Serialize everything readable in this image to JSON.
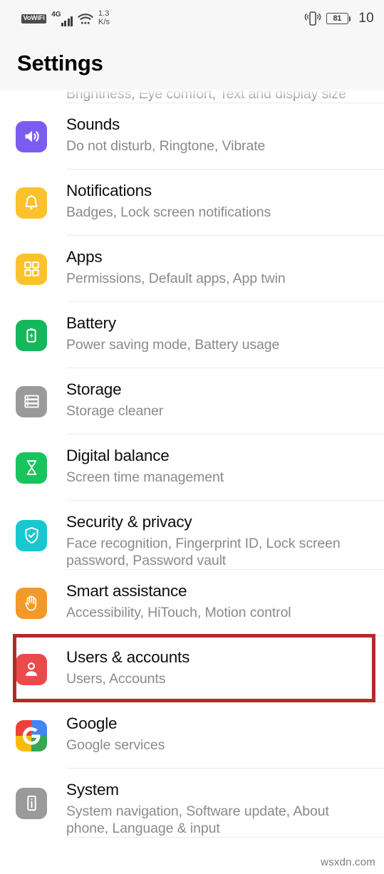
{
  "status_bar": {
    "vowifi_label": "VoWiFi",
    "network_label": "4G",
    "network_sub": "⁴ᴳ",
    "data_speed_value": "1.3",
    "data_speed_unit": "K/s",
    "battery_percent": "81",
    "clock": "10",
    "signal_bars": 4,
    "icons": {
      "wifi": "wifi-icon",
      "vibrate": "vibrate-icon",
      "battery": "battery-icon"
    }
  },
  "header": {
    "title": "Settings"
  },
  "highlight": {
    "color": "#b42a2a",
    "target": "Users & accounts"
  },
  "watermark": "wsxdn.com",
  "settings_list": [
    {
      "id": "display",
      "title": "",
      "subtitle": "Brightness, Eye comfort, Text and display size",
      "icon": "display-icon",
      "icon_color": "#2b9cf0",
      "partial": true
    },
    {
      "id": "sounds",
      "title": "Sounds",
      "subtitle": "Do not disturb, Ringtone, Vibrate",
      "icon": "speaker-icon",
      "icon_color": "#7c5cf0"
    },
    {
      "id": "notifications",
      "title": "Notifications",
      "subtitle": "Badges, Lock screen notifications",
      "icon": "bell-icon",
      "icon_color": "#fbc22d"
    },
    {
      "id": "apps",
      "title": "Apps",
      "subtitle": "Permissions, Default apps, App twin",
      "icon": "apps-grid-icon",
      "icon_color": "#fbc22d"
    },
    {
      "id": "battery",
      "title": "Battery",
      "subtitle": "Power saving mode, Battery usage",
      "icon": "battery-bolt-icon",
      "icon_color": "#14b85a"
    },
    {
      "id": "storage",
      "title": "Storage",
      "subtitle": "Storage cleaner",
      "icon": "storage-icon",
      "icon_color": "#9a9a9a"
    },
    {
      "id": "digital-balance",
      "title": "Digital balance",
      "subtitle": "Screen time management",
      "icon": "hourglass-icon",
      "icon_color": "#18c45e"
    },
    {
      "id": "security-privacy",
      "title": "Security & privacy",
      "subtitle": "Face recognition, Fingerprint ID, Lock screen password, Password vault",
      "icon": "shield-check-icon",
      "icon_color": "#18c8cf"
    },
    {
      "id": "smart-assistance",
      "title": "Smart assistance",
      "subtitle": "Accessibility, HiTouch, Motion control",
      "icon": "hand-icon",
      "icon_color": "#f3992a"
    },
    {
      "id": "users-accounts",
      "title": "Users & accounts",
      "subtitle": "Users, Accounts",
      "icon": "user-icon",
      "icon_color": "#e94b4b",
      "highlighted": true
    },
    {
      "id": "google",
      "title": "Google",
      "subtitle": "Google services",
      "icon": "google-g-icon",
      "icon_color": "#ffffff"
    },
    {
      "id": "system",
      "title": "System",
      "subtitle": "System navigation, Software update, About phone, Language & input",
      "icon": "phone-info-icon",
      "icon_color": "#9a9a9a"
    }
  ]
}
